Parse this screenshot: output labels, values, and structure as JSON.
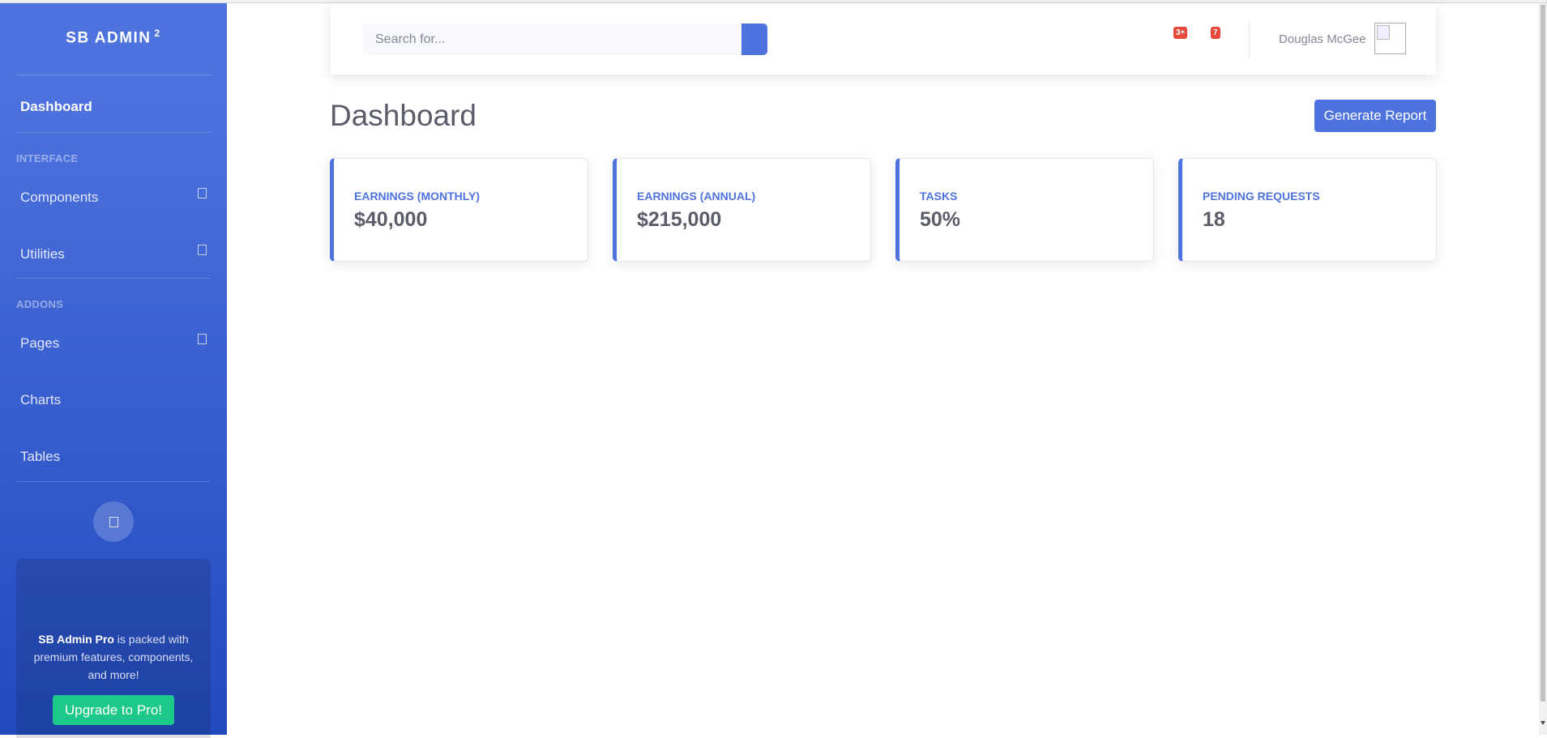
{
  "sidebar": {
    "brand": "SB ADMIN",
    "brand_sup": "2",
    "items": [
      {
        "label": "Dashboard"
      },
      {
        "label": "Components"
      },
      {
        "label": "Utilities"
      },
      {
        "label": "Pages"
      },
      {
        "label": "Charts"
      },
      {
        "label": "Tables"
      }
    ],
    "headings": [
      "INTERFACE",
      "ADDONS"
    ],
    "promo": {
      "bold": "SB Admin Pro",
      "text": " is packed with premium features, components, and more!",
      "button": "Upgrade to Pro!"
    }
  },
  "topbar": {
    "search_placeholder": "Search for...",
    "alerts_badge": "3+",
    "messages_badge": "7",
    "user_name": "Douglas McGee"
  },
  "page": {
    "title": "Dashboard",
    "report_button": "Generate Report"
  },
  "cards": [
    {
      "label": "EARNINGS (MONTHLY)",
      "value": "$40,000"
    },
    {
      "label": "EARNINGS (ANNUAL)",
      "value": "$215,000"
    },
    {
      "label": "TASKS",
      "value": "50%"
    },
    {
      "label": "PENDING REQUESTS",
      "value": "18"
    }
  ],
  "colors": {
    "primary": "#4e73df",
    "success": "#1cc88a",
    "danger": "#e74a3b",
    "text": "#5a5c69"
  }
}
